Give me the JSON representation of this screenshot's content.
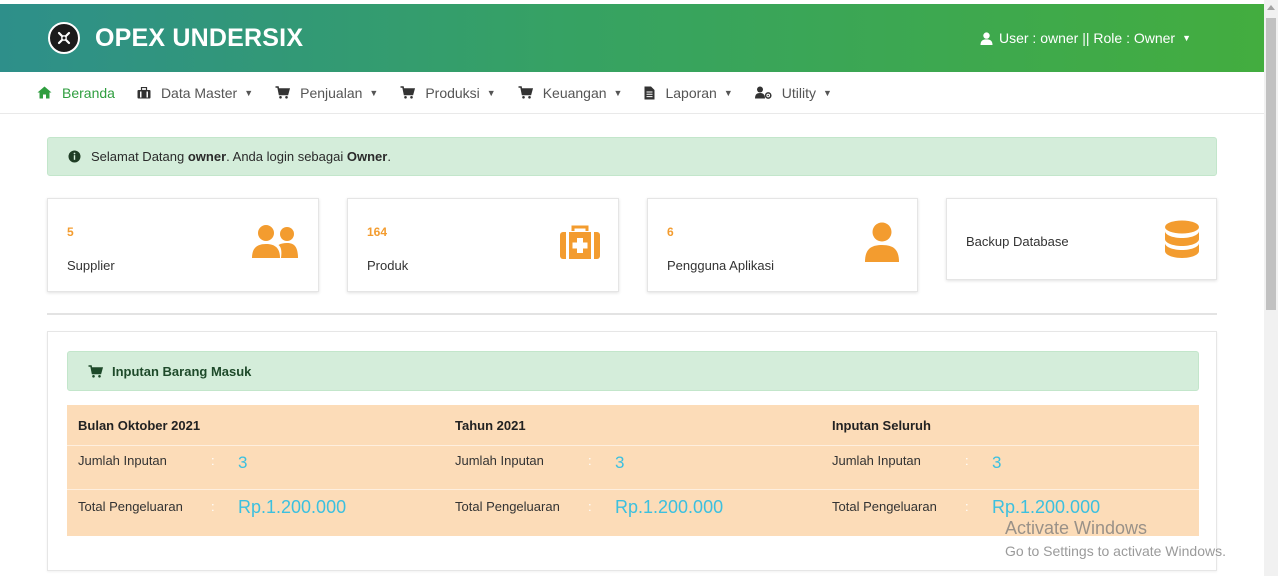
{
  "app": {
    "brand": "OPEX UNDERSIX",
    "user_menu": "User : owner || Role : Owner"
  },
  "menu": [
    {
      "label": "Beranda",
      "icon": "home-icon"
    },
    {
      "label": "Data Master",
      "icon": "briefcase-icon"
    },
    {
      "label": "Penjualan",
      "icon": "cart-icon"
    },
    {
      "label": "Produksi",
      "icon": "cart-icon"
    },
    {
      "label": "Keuangan",
      "icon": "cart-icon"
    },
    {
      "label": "Laporan",
      "icon": "file-icon"
    },
    {
      "label": "Utility",
      "icon": "user-cog-icon"
    }
  ],
  "alert": {
    "prefix": "Selamat Datang ",
    "user": "owner",
    "middle": ". Anda login sebagai ",
    "role": "Owner",
    "suffix": "."
  },
  "cards": [
    {
      "count": "5",
      "label": "Supplier",
      "icon": "users-icon"
    },
    {
      "count": "164",
      "label": "Produk",
      "icon": "medkit-icon"
    },
    {
      "count": "6",
      "label": "Pengguna Aplikasi",
      "icon": "user-icon"
    },
    {
      "count": "",
      "label": "Backup Database",
      "icon": "database-icon"
    }
  ],
  "panel": {
    "title": "Inputan Barang Masuk",
    "columns": [
      {
        "title": "Bulan Oktober 2021",
        "count_label": "Jumlah Inputan",
        "count_value": "3",
        "total_label": "Total Pengeluaran",
        "total_value": "Rp.1.200.000"
      },
      {
        "title": "Tahun 2021",
        "count_label": "Jumlah Inputan",
        "count_value": "3",
        "total_label": "Total Pengeluaran",
        "total_value": "Rp.1.200.000"
      },
      {
        "title": "Inputan Seluruh",
        "count_label": "Jumlah Inputan",
        "count_value": "3",
        "total_label": "Total Pengeluaran",
        "total_value": "Rp.1.200.000"
      }
    ],
    "colon": ":"
  },
  "watermark": {
    "line1": "Activate Windows",
    "line2": "Go to Settings to activate Windows."
  },
  "colors": {
    "accent_orange": "#f39c2f",
    "value_cyan": "#3cc0df",
    "navbar_start": "#2e8f8a",
    "navbar_end": "#43ad3f",
    "alert_bg": "#d4edda",
    "stats_bg": "#fcdcb8"
  }
}
